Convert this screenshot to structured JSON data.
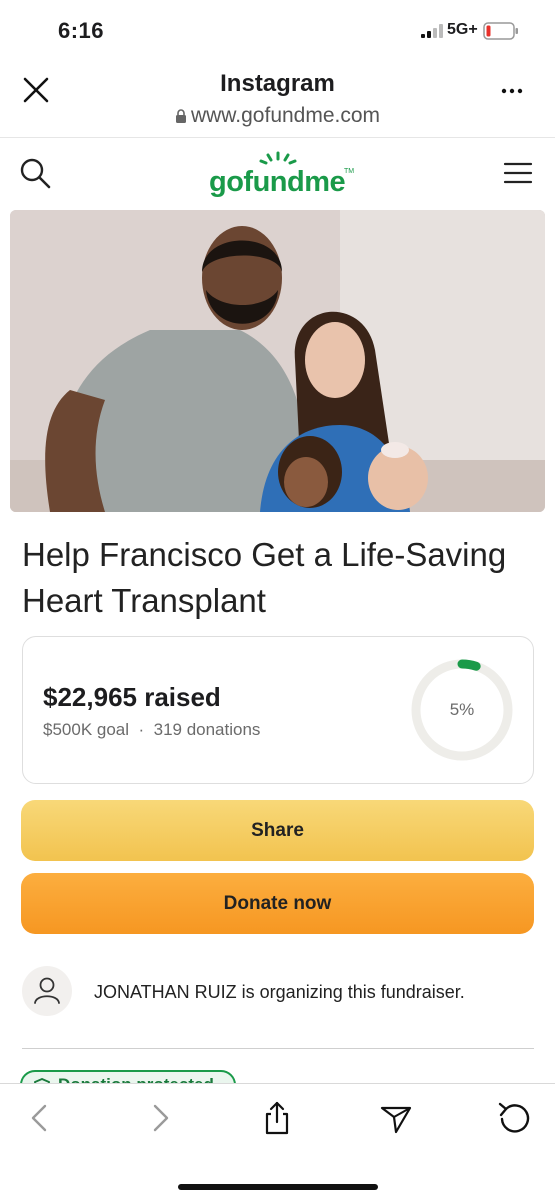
{
  "status_bar": {
    "time": "6:16",
    "network": "5G+"
  },
  "browser_header": {
    "title": "Instagram",
    "url": "www.gofundme.com"
  },
  "site": {
    "logo_text": "gofundme",
    "logo_tm": "TM",
    "brand_color": "#1a9a49"
  },
  "campaign": {
    "title": "Help Francisco Get a Life-Saving Heart Transplant",
    "raised": "$22,965 raised",
    "goal": "$500K goal",
    "separator": "·",
    "donations": "319 donations",
    "progress_label": "5%",
    "progress_fraction": 0.05
  },
  "actions": {
    "share_label": "Share",
    "donate_label": "Donate now"
  },
  "organizer": {
    "text": "JONATHAN RUIZ is organizing this fundraiser."
  },
  "badge": {
    "label": "Donation protected"
  },
  "toolbar": {
    "icons": [
      "back-icon",
      "forward-icon",
      "share-icon",
      "send-icon",
      "refresh-icon"
    ]
  },
  "colors": {
    "share_button": "#f2c34f",
    "donate_button": "#f69722",
    "progress_track": "#eeede9"
  }
}
